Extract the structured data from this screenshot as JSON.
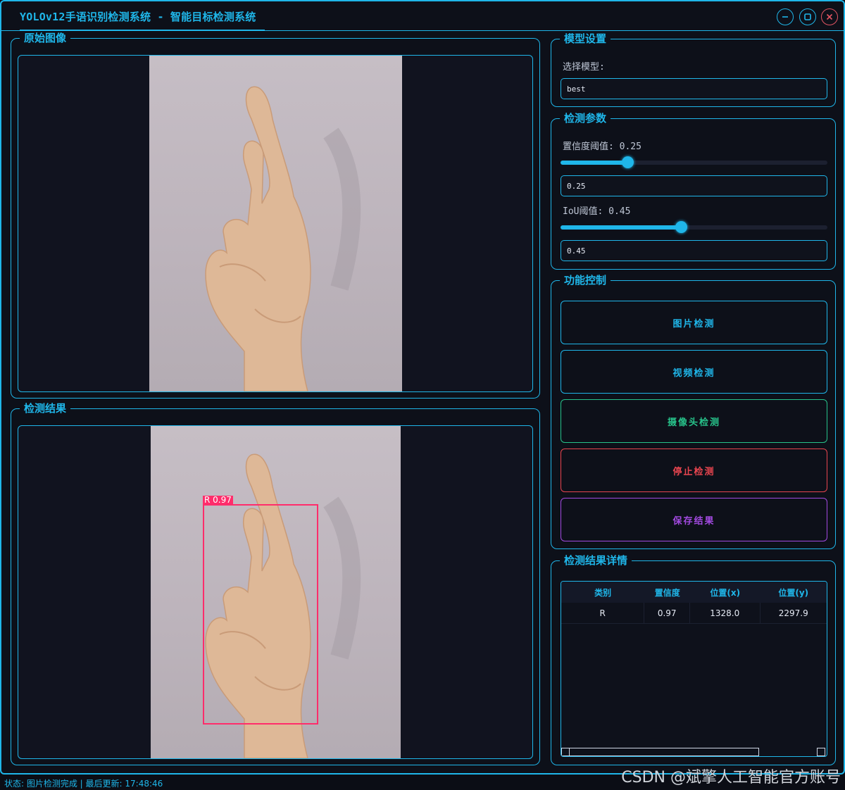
{
  "window": {
    "title": "YOLOv12手语识别检测系统 - 智能目标检测系统",
    "accent": "#1fb6e9"
  },
  "original_panel": {
    "title": "原始图像"
  },
  "result_panel": {
    "title": "检测结果",
    "detection_label": "R 0.97",
    "box_color": "#ff2d6b"
  },
  "model_settings": {
    "title": "模型设置",
    "select_label": "选择模型:",
    "selected_model": "best"
  },
  "detect_params": {
    "title": "检测参数",
    "conf_label": "置信度阈值: 0.25",
    "conf_value": "0.25",
    "conf_fraction": 0.25,
    "iou_label": "IoU阈值: 0.45",
    "iou_value": "0.45",
    "iou_fraction": 0.45
  },
  "controls": {
    "title": "功能控制",
    "image_detect": "图片检测",
    "video_detect": "视频检测",
    "camera_detect": "摄像头检测",
    "stop_detect": "停止检测",
    "save_result": "保存结果"
  },
  "results_table": {
    "title": "检测结果详情",
    "columns": [
      "类别",
      "置信度",
      "位置(x)",
      "位置(y)"
    ],
    "rows": [
      [
        "R",
        "0.97",
        "1328.0",
        "2297.9"
      ]
    ]
  },
  "status": {
    "text": "状态: 图片检测完成 | 最后更新: 17:48:46",
    "watermark": "CSDN @斌擎人工智能官方账号"
  },
  "icons": {
    "minimize": "minimize-icon",
    "maximize": "maximize-icon",
    "close": "close-icon"
  }
}
